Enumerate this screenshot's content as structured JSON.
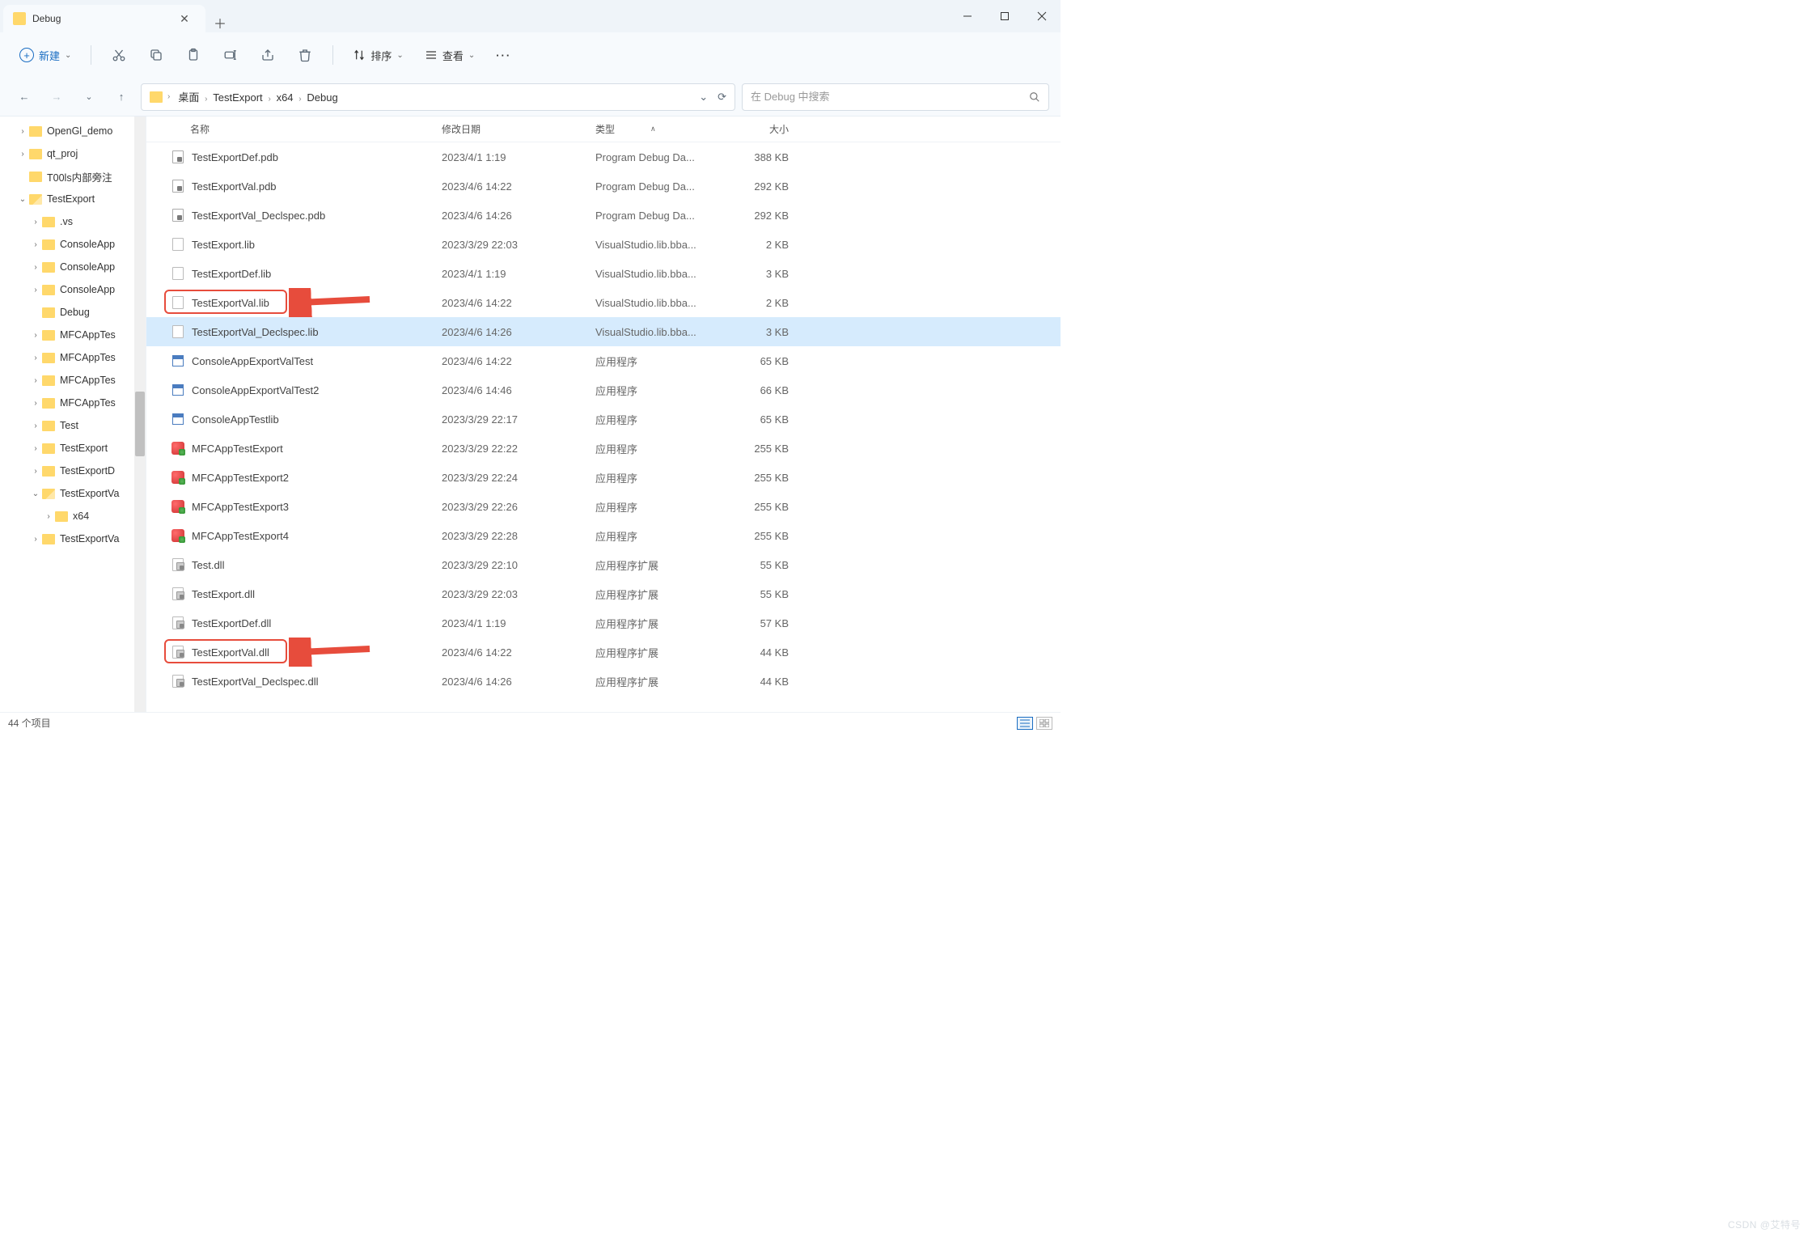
{
  "window": {
    "tab_title": "Debug"
  },
  "toolbar": {
    "new_label": "新建",
    "sort_label": "排序",
    "view_label": "查看"
  },
  "breadcrumbs": [
    "桌面",
    "TestExport",
    "x64",
    "Debug"
  ],
  "search": {
    "placeholder": "在 Debug 中搜索"
  },
  "sidebar_items": [
    {
      "label": "OpenGl_demo",
      "depth": 1,
      "chev": "›"
    },
    {
      "label": "qt_proj",
      "depth": 1,
      "chev": "›"
    },
    {
      "label": "T00ls内部旁注",
      "depth": 1,
      "chev": ""
    },
    {
      "label": "TestExport",
      "depth": 1,
      "chev": "⌄",
      "open": true
    },
    {
      "label": ".vs",
      "depth": 2,
      "chev": "›"
    },
    {
      "label": "ConsoleApp",
      "depth": 2,
      "chev": "›"
    },
    {
      "label": "ConsoleApp",
      "depth": 2,
      "chev": "›"
    },
    {
      "label": "ConsoleApp",
      "depth": 2,
      "chev": "›"
    },
    {
      "label": "Debug",
      "depth": 2,
      "chev": ""
    },
    {
      "label": "MFCAppTes",
      "depth": 2,
      "chev": "›"
    },
    {
      "label": "MFCAppTes",
      "depth": 2,
      "chev": "›"
    },
    {
      "label": "MFCAppTes",
      "depth": 2,
      "chev": "›"
    },
    {
      "label": "MFCAppTes",
      "depth": 2,
      "chev": "›"
    },
    {
      "label": "Test",
      "depth": 2,
      "chev": "›"
    },
    {
      "label": "TestExport",
      "depth": 2,
      "chev": "›"
    },
    {
      "label": "TestExportD",
      "depth": 2,
      "chev": "›"
    },
    {
      "label": "TestExportVa",
      "depth": 2,
      "chev": "⌄",
      "open": true
    },
    {
      "label": "x64",
      "depth": 3,
      "chev": "›"
    },
    {
      "label": "TestExportVa",
      "depth": 2,
      "chev": "›"
    }
  ],
  "columns": {
    "name": "名称",
    "date": "修改日期",
    "type": "类型",
    "size": "大小"
  },
  "files": [
    {
      "name": "TestExportDef.pdb",
      "date": "2023/4/1 1:19",
      "type": "Program Debug Da...",
      "size": "388 KB",
      "icon": "pdb"
    },
    {
      "name": "TestExportVal.pdb",
      "date": "2023/4/6 14:22",
      "type": "Program Debug Da...",
      "size": "292 KB",
      "icon": "pdb"
    },
    {
      "name": "TestExportVal_Declspec.pdb",
      "date": "2023/4/6 14:26",
      "type": "Program Debug Da...",
      "size": "292 KB",
      "icon": "pdb"
    },
    {
      "name": "TestExport.lib",
      "date": "2023/3/29 22:03",
      "type": "VisualStudio.lib.bba...",
      "size": "2 KB",
      "icon": "generic"
    },
    {
      "name": "TestExportDef.lib",
      "date": "2023/4/1 1:19",
      "type": "VisualStudio.lib.bba...",
      "size": "3 KB",
      "icon": "generic"
    },
    {
      "name": "TestExportVal.lib",
      "date": "2023/4/6 14:22",
      "type": "VisualStudio.lib.bba...",
      "size": "2 KB",
      "icon": "generic",
      "highlight": true
    },
    {
      "name": "TestExportVal_Declspec.lib",
      "date": "2023/4/6 14:26",
      "type": "VisualStudio.lib.bba...",
      "size": "3 KB",
      "icon": "generic",
      "selected": true
    },
    {
      "name": "ConsoleAppExportValTest",
      "date": "2023/4/6 14:22",
      "type": "应用程序",
      "size": "65 KB",
      "icon": "exe"
    },
    {
      "name": "ConsoleAppExportValTest2",
      "date": "2023/4/6 14:46",
      "type": "应用程序",
      "size": "66 KB",
      "icon": "exe"
    },
    {
      "name": "ConsoleAppTestlib",
      "date": "2023/3/29 22:17",
      "type": "应用程序",
      "size": "65 KB",
      "icon": "exe"
    },
    {
      "name": "MFCAppTestExport",
      "date": "2023/3/29 22:22",
      "type": "应用程序",
      "size": "255 KB",
      "icon": "mfc"
    },
    {
      "name": "MFCAppTestExport2",
      "date": "2023/3/29 22:24",
      "type": "应用程序",
      "size": "255 KB",
      "icon": "mfc"
    },
    {
      "name": "MFCAppTestExport3",
      "date": "2023/3/29 22:26",
      "type": "应用程序",
      "size": "255 KB",
      "icon": "mfc"
    },
    {
      "name": "MFCAppTestExport4",
      "date": "2023/3/29 22:28",
      "type": "应用程序",
      "size": "255 KB",
      "icon": "mfc"
    },
    {
      "name": "Test.dll",
      "date": "2023/3/29 22:10",
      "type": "应用程序扩展",
      "size": "55 KB",
      "icon": "dll"
    },
    {
      "name": "TestExport.dll",
      "date": "2023/3/29 22:03",
      "type": "应用程序扩展",
      "size": "55 KB",
      "icon": "dll"
    },
    {
      "name": "TestExportDef.dll",
      "date": "2023/4/1 1:19",
      "type": "应用程序扩展",
      "size": "57 KB",
      "icon": "dll"
    },
    {
      "name": "TestExportVal.dll",
      "date": "2023/4/6 14:22",
      "type": "应用程序扩展",
      "size": "44 KB",
      "icon": "dll",
      "highlight": true
    },
    {
      "name": "TestExportVal_Declspec.dll",
      "date": "2023/4/6 14:26",
      "type": "应用程序扩展",
      "size": "44 KB",
      "icon": "dll"
    }
  ],
  "status": {
    "item_count": "44 个项目"
  },
  "watermark": "CSDN @艾特号"
}
